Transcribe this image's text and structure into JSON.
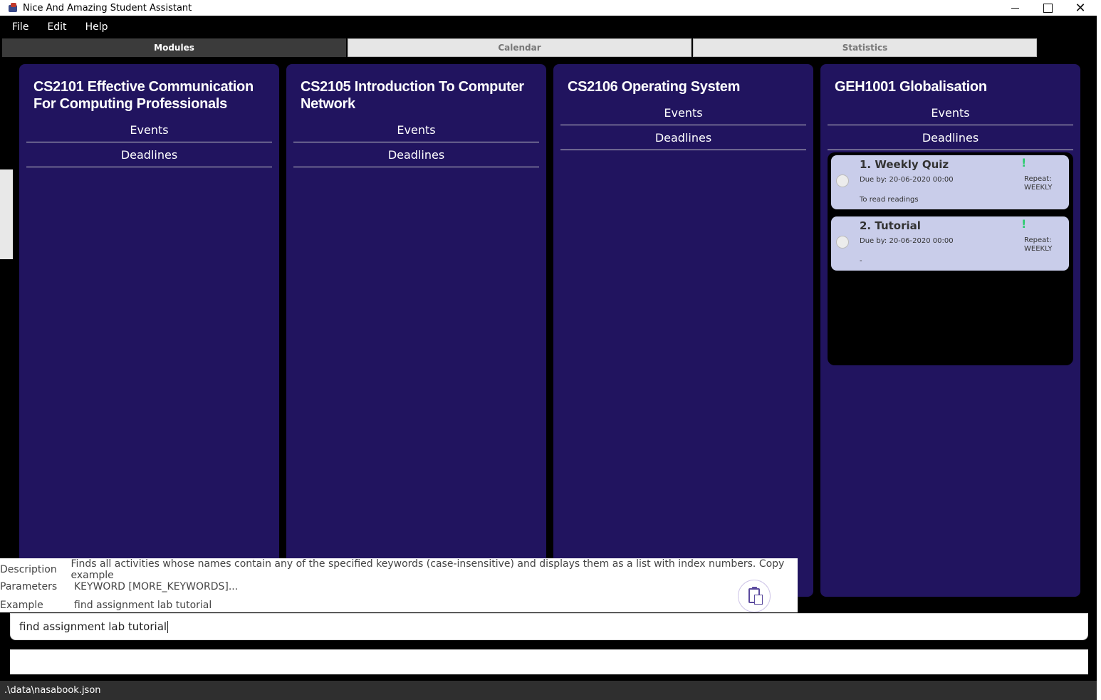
{
  "window": {
    "title": "Nice And Amazing Student Assistant"
  },
  "menu": {
    "file": "File",
    "edit": "Edit",
    "help": "Help"
  },
  "tabs": {
    "modules": "Modules",
    "calendar": "Calendar",
    "statistics": "Statistics"
  },
  "modules": [
    {
      "title": "CS2101 Effective Communication For Computing Professionals",
      "events": "Events",
      "deadlines": "Deadlines"
    },
    {
      "title": "CS2105 Introduction To Computer Network",
      "events": "Events",
      "deadlines": "Deadlines"
    },
    {
      "title": "CS2106 Operating System",
      "events": "Events",
      "deadlines": "Deadlines"
    },
    {
      "title": "GEH1001 Globalisation",
      "events": "Events",
      "deadlines": "Deadlines",
      "deadline_items": [
        {
          "title": "1. Weekly Quiz",
          "due": "Due by: 20-06-2020 00:00",
          "description": "To read readings",
          "priority": "!",
          "repeat_label": "Repeat:",
          "repeat_value": "WEEKLY"
        },
        {
          "title": "2. Tutorial",
          "due": "Due by: 20-06-2020 00:00",
          "description": "-",
          "priority": "!",
          "repeat_label": "Repeat:",
          "repeat_value": "WEEKLY"
        }
      ]
    }
  ],
  "help_popup": {
    "description_label": "Description",
    "description": "Finds all activities whose names contain any of the specified keywords (case-insensitive) and displays them as a list with index numbers.  Copy example",
    "parameters_label": "Parameters",
    "parameters": "KEYWORD [MORE_KEYWORDS]...",
    "example_label": "Example",
    "example": "find assignment lab tutorial"
  },
  "command": {
    "value": "find assignment lab tutorial"
  },
  "status": {
    "path": ".\\data\\nasabook.json"
  }
}
